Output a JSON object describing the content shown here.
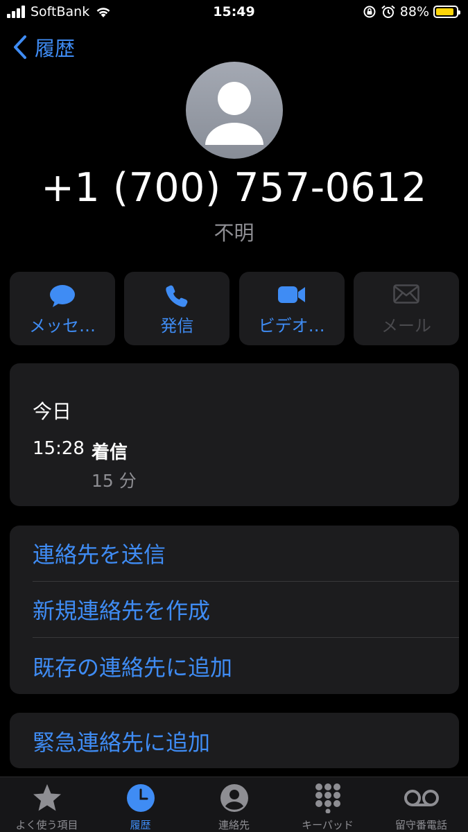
{
  "status_bar": {
    "carrier": "SoftBank",
    "time": "15:49",
    "battery_percent": "88%",
    "battery_level": 0.88
  },
  "nav": {
    "back_label": "履歴"
  },
  "contact": {
    "phone_number": "+1 (700) 757-0612",
    "label": "不明"
  },
  "actions": [
    {
      "label": "メッセ…",
      "icon": "message-bubble-icon",
      "enabled": true
    },
    {
      "label": "発信",
      "icon": "phone-icon",
      "enabled": true
    },
    {
      "label": "ビデオ…",
      "icon": "video-camera-icon",
      "enabled": true
    },
    {
      "label": "メール",
      "icon": "envelope-icon",
      "enabled": false
    }
  ],
  "history": {
    "day": "今日",
    "time": "15:28",
    "type": "着信",
    "duration": "15 分"
  },
  "options": [
    "連絡先を送信",
    "新規連絡先を作成",
    "既存の連絡先に追加"
  ],
  "emergency_option": "緊急連絡先に追加",
  "tab_bar": [
    {
      "label": "よく使う項目",
      "icon": "star-icon",
      "active": false
    },
    {
      "label": "履歴",
      "icon": "clock-icon",
      "active": true
    },
    {
      "label": "連絡先",
      "icon": "person-circle-icon",
      "active": false
    },
    {
      "label": "キーパッド",
      "icon": "keypad-icon",
      "active": false
    },
    {
      "label": "留守番電話",
      "icon": "voicemail-icon",
      "active": false
    }
  ],
  "colors": {
    "accent": "#3f8cf4",
    "background": "#000000",
    "card": "#1c1c1e",
    "secondary_text": "#8e8e93",
    "battery": "#ffd60a"
  }
}
